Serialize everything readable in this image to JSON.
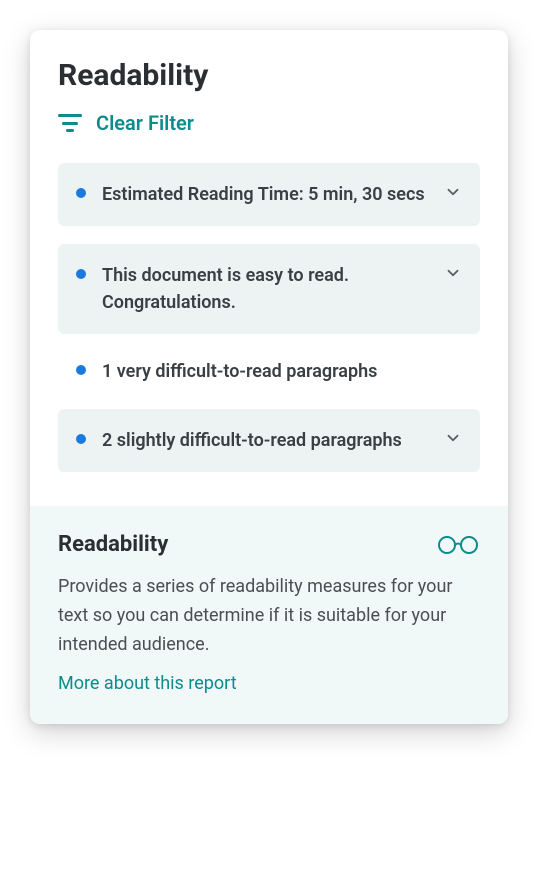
{
  "header": {
    "title": "Readability",
    "clear_filter_label": "Clear Filter"
  },
  "items": [
    {
      "text": "Estimated Reading Time: 5 min, 30 secs",
      "style": "info",
      "expandable": true
    },
    {
      "text": "This document is easy to read. Congratulations.",
      "style": "info",
      "expandable": true
    },
    {
      "text": "1 very difficult-to-read paragraphs",
      "style": "plain",
      "expandable": false
    },
    {
      "text": "2 slightly difficult-to-read paragraphs",
      "style": "info",
      "expandable": true
    }
  ],
  "info": {
    "title": "Readability",
    "description": "Provides a series of readability measures for your text so you can determine if it is suitable for your intended audience.",
    "link_label": "More about this report"
  }
}
